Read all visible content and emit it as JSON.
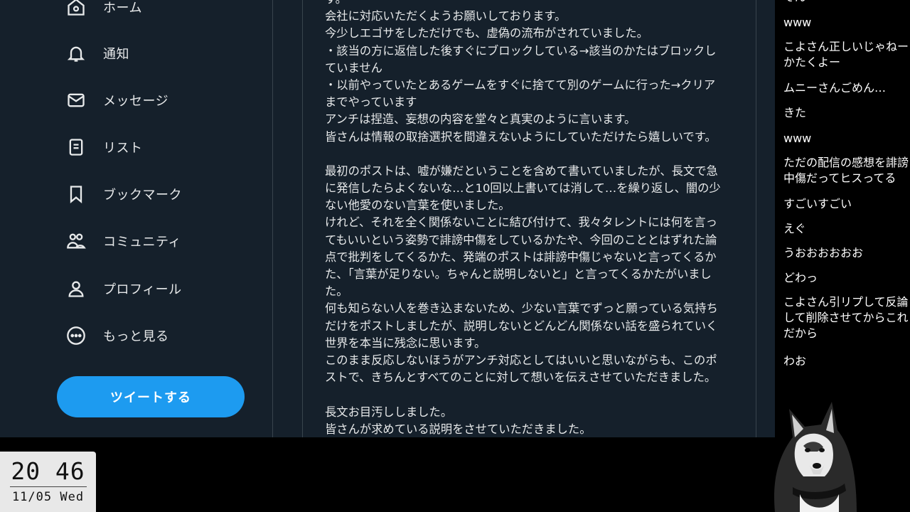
{
  "sidebar": {
    "items": [
      {
        "label": "ホーム",
        "icon": "home-icon"
      },
      {
        "label": "通知",
        "icon": "bell-icon"
      },
      {
        "label": "メッセージ",
        "icon": "mail-icon"
      },
      {
        "label": "リスト",
        "icon": "list-icon"
      },
      {
        "label": "ブックマーク",
        "icon": "bookmark-icon"
      },
      {
        "label": "コミュニティ",
        "icon": "community-icon"
      },
      {
        "label": "プロフィール",
        "icon": "profile-icon"
      },
      {
        "label": "もっと見る",
        "icon": "more-icon"
      }
    ],
    "tweet_button": "ツイートする"
  },
  "post": {
    "lines": [
      "す。",
      "会社に対応いただくようお願いしております。",
      "今少しエゴサをしただけでも、虚偽の流布がされていました。",
      "・該当の方に返信した後すぐにブロックしている→該当のかたはブロックし",
      "ていません",
      "・以前やっていたとあるゲームをすぐに捨てて別のゲームに行った→クリア",
      "までやっています",
      "アンチは捏造、妄想の内容を堂々と真実のように言います。",
      "皆さんは情報の取捨選択を間違えないようにしていただけたら嬉しいです。",
      "",
      "最初のポストは、嘘が嫌だということを含めて書いていましたが、長文で急",
      "に発信したらよくないな…と10回以上書いては消して…を繰り返し、闇の少",
      "ない他愛のない言葉を使いました。",
      "けれど、それを全く関係ないことに結び付けて、我々タレントには何を言っ",
      "てもいいという姿勢で誹謗中傷をしているかたや、今回のこととはずれた論",
      "点で批判をしてくるかた、発端のポストは誹謗中傷じゃないと言ってくるか",
      "た、「言葉が足りない。ちゃんと説明しないと」と言ってくるかたがいまし",
      "た。",
      "何も知らない人を巻き込まないため、少ない言葉でずっと願っている気持ち",
      "だけをポストしましたが、説明しないとどんどん関係ない話を盛られていく",
      "世界を本当に残念に思います。",
      "このまま反応しないほうがアンチ対応としてはいいと思いながらも、このポ",
      "ストで、きちんとすべてのことに対して想いを伝えさせていただきました。",
      "",
      "長文お目汚ししました。",
      "皆さんが求めている説明をさせていただきました。"
    ]
  },
  "chat": {
    "messages": [
      "そん",
      "www",
      "こよさん正しいじゃねーかたくよー",
      "ムニーさんごめん…",
      "きた",
      "www",
      "ただの配信の感想を誹謗中傷だってヒスってる",
      "すごいすごい",
      "えぐ",
      "うおおおおおお",
      "どわっ",
      "こよさん引リプして反論して削除させてからこれだから",
      "わお"
    ]
  },
  "clock": {
    "time": "20 46",
    "date": "11/05 Wed"
  },
  "colors": {
    "background": "#15202b",
    "accent": "#1d9bf0",
    "text": "#e7e9ea",
    "divider": "#38444d"
  }
}
